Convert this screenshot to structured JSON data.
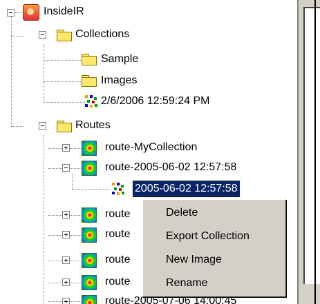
{
  "tree": {
    "root": {
      "label": "InsideIR"
    },
    "collections": {
      "label": "Collections",
      "children": [
        {
          "label": "Sample"
        },
        {
          "label": "Images"
        },
        {
          "label": "2/6/2006 12:59:24 PM"
        }
      ]
    },
    "routes": {
      "label": "Routes",
      "children": [
        {
          "label": "route-MyCollection"
        },
        {
          "label": "route-2005-06-02 12:57:58",
          "child": {
            "label": "2005-06-02 12:57:58"
          }
        },
        {
          "label": "route"
        },
        {
          "label": "route"
        },
        {
          "label": "route"
        },
        {
          "label": "route"
        },
        {
          "label": "route-2005-07-06 14:00:45"
        }
      ]
    }
  },
  "context_menu": {
    "items": [
      "Delete",
      "Export Collection",
      "New Image",
      "Rename"
    ]
  }
}
